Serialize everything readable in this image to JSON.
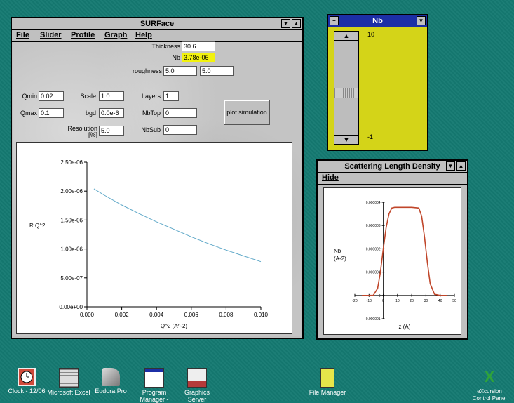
{
  "surface": {
    "title": "SURFace",
    "menu": [
      "File",
      "Slider",
      "Profile",
      "Graph",
      "Help"
    ],
    "fields": {
      "thickness_label": "Thickness",
      "thickness": "30.6",
      "nb_label": "Nb",
      "nb": "3.78e-06",
      "roughness_label": "roughness",
      "roughness1": "5.0",
      "roughness2": "5.0",
      "qmin_label": "Qmin",
      "qmin": "0.02",
      "qmax_label": "Qmax",
      "qmax": "0.1",
      "scale_label": "Scale",
      "scale": "1.0",
      "bgd_label": "bgd",
      "bgd": "0.0e-6",
      "resolution_label": "Resolution\n[%]",
      "resolution": "5.0",
      "layers_label": "Layers",
      "layers": "1",
      "nbtop_label": "NbTop",
      "nbtop": "0",
      "nbsub_label": "NbSub",
      "nbsub": "0"
    },
    "plot_button": "plot simulation"
  },
  "chart_data": [
    {
      "type": "line",
      "xlabel": "Q^2 (A^-2)",
      "ylabel": "R.Q^2",
      "xlim": [
        0,
        0.01
      ],
      "ylim": [
        0,
        2.5e-06
      ],
      "xticks": [
        "0.000",
        "0.002",
        "0.004",
        "0.006",
        "0.008",
        "0.010"
      ],
      "yticks": [
        "0.00e+00",
        "5.00e-07",
        "1.00e-06",
        "1.50e-06",
        "2.00e-06",
        "2.50e-06"
      ],
      "series": [
        {
          "x": [
            0.0004,
            0.001,
            0.002,
            0.003,
            0.004,
            0.005,
            0.006,
            0.007,
            0.008,
            0.009,
            0.01
          ],
          "values": [
            2.04e-06,
            1.93e-06,
            1.76e-06,
            1.61e-06,
            1.47e-06,
            1.34e-06,
            1.21e-06,
            1.09e-06,
            9.8e-07,
            8.8e-07,
            7.8e-07
          ],
          "color": "#5fa8c8"
        }
      ]
    },
    {
      "type": "line",
      "xlabel": "z (A)",
      "ylabel": "Nb\n(A-2)",
      "yticks": [
        "0.000004",
        "0.000003",
        "0.000002",
        "0.000001",
        "0",
        "-0.000001"
      ],
      "xticks": [
        "-20",
        "-10",
        "0",
        "10",
        "20",
        "30",
        "40",
        "50"
      ],
      "xlim": [
        -20,
        50
      ],
      "ylim": [
        -1e-06,
        4e-06
      ],
      "series": [
        {
          "x": [
            -15,
            -10,
            -7,
            -4,
            -2,
            0,
            2,
            4,
            6,
            8,
            10,
            20,
            25,
            27,
            29,
            31,
            33,
            36,
            40,
            45
          ],
          "values": [
            0,
            0,
            1e-08,
            3e-07,
            1e-06,
            2e-06,
            2.9e-06,
            3.5e-06,
            3.75e-06,
            3.78e-06,
            3.78e-06,
            3.78e-06,
            3.75e-06,
            3.4e-06,
            2.5e-06,
            1.4e-06,
            5e-07,
            5e-08,
            0,
            0
          ],
          "color": "#c0462a"
        }
      ]
    }
  ],
  "nb_window": {
    "title": "Nb",
    "max": "10",
    "min": "-1"
  },
  "sld_window": {
    "title": "Scattering Length Density",
    "menu": "Hide"
  },
  "taskbar": [
    {
      "label": "Clock - 12/06",
      "icon": "clock-icon"
    },
    {
      "label": "Microsoft Excel",
      "icon": "excel-icon"
    },
    {
      "label": "Eudora Pro",
      "icon": "eudora-icon"
    },
    {
      "label": "Program\nManager -",
      "icon": "program-manager-icon"
    },
    {
      "label": "Graphics\nServer",
      "icon": "graphics-server-icon"
    },
    {
      "label": "File Manager",
      "icon": "file-manager-icon"
    },
    {
      "label": "eXcursion\nControl Panel",
      "icon": "excursion-icon"
    }
  ]
}
